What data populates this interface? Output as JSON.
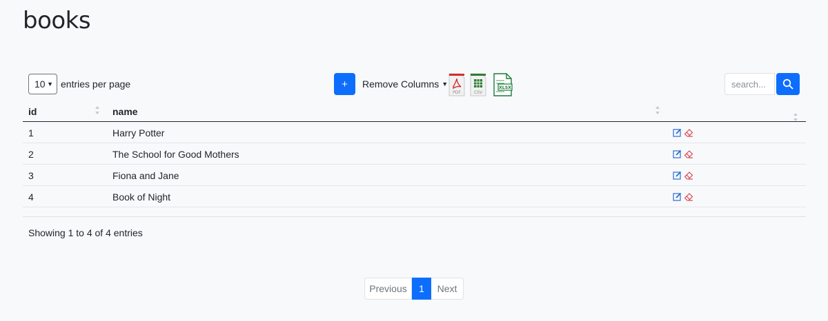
{
  "page": {
    "title": "books"
  },
  "toolbar": {
    "per_page_value": "10",
    "per_page_label": "entries per page",
    "add_label": "+",
    "remove_columns_label": "Remove Columns",
    "export": {
      "pdf_label": "PDF",
      "csv_label": "CSV",
      "xlsx_label": "XLSX"
    },
    "search_placeholder": "search..."
  },
  "table": {
    "columns": [
      "id",
      "name"
    ],
    "rows": [
      {
        "id": "1",
        "name": "Harry Potter"
      },
      {
        "id": "2",
        "name": "The School for Good Mothers"
      },
      {
        "id": "3",
        "name": "Fiona and Jane"
      },
      {
        "id": "4",
        "name": "Book of Night"
      }
    ]
  },
  "footer": {
    "summary": "Showing 1 to 4 of 4 entries",
    "pagination": {
      "previous": "Previous",
      "current": "1",
      "next": "Next"
    }
  },
  "colors": {
    "primary": "#0d6efd",
    "edit": "#2a6bd8",
    "delete": "#dc3545",
    "pdf": "#d32f2f",
    "csv": "#2e7d32",
    "xlsx": "#1b7a3a"
  }
}
